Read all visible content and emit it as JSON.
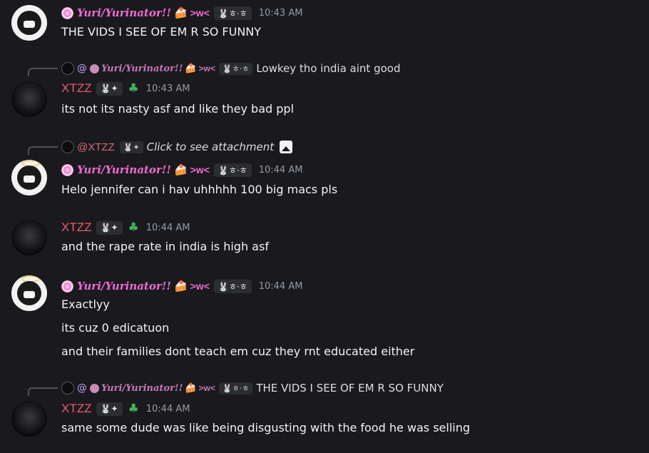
{
  "users": {
    "yuri": {
      "name": "Yuri/Yurinator!!",
      "cake": "🍰",
      "face": ">w<",
      "tag": "🐰ㅎ·ㅎ"
    },
    "xtzz": {
      "name": "XTZZ",
      "tag": "🐰✦",
      "clover": "♣"
    }
  },
  "messages": [
    {
      "author": "Yuri/Yurinator!!",
      "time": "10:43 AM",
      "lines": [
        "THE VIDS I SEE OF EM R SO FUNNY"
      ]
    },
    {
      "reply": {
        "at": "@",
        "name": "Yuri/Yurinator!!",
        "text": "Lowkey tho india aint good"
      },
      "author": "XTZZ",
      "time": "10:43 AM",
      "lines": [
        "its not its nasty asf and like they bad ppl"
      ]
    },
    {
      "reply": {
        "at": "@XTZZ",
        "text": "Click to see attachment"
      },
      "author": "Yuri/Yurinator!!",
      "time": "10:44 AM",
      "lines": [
        "Helo jennifer can i hav uhhhhh 100 big macs pls"
      ]
    },
    {
      "author": "XTZZ",
      "time": "10:44 AM",
      "lines": [
        "and the rape rate in india is high asf"
      ]
    },
    {
      "author": "Yuri/Yurinator!!",
      "time": "10:44 AM",
      "lines": [
        "Exactlyy",
        "its cuz 0 edicatuon",
        "and their families dont teach em cuz they rnt educated either"
      ]
    },
    {
      "reply": {
        "at": "@",
        "name": "Yuri/Yurinator!!",
        "text": "THE VIDS I SEE OF EM R SO FUNNY"
      },
      "author": "XTZZ",
      "time": "10:44 AM",
      "lines": [
        "same some dude was like being disgusting with the food he was selling"
      ]
    }
  ]
}
